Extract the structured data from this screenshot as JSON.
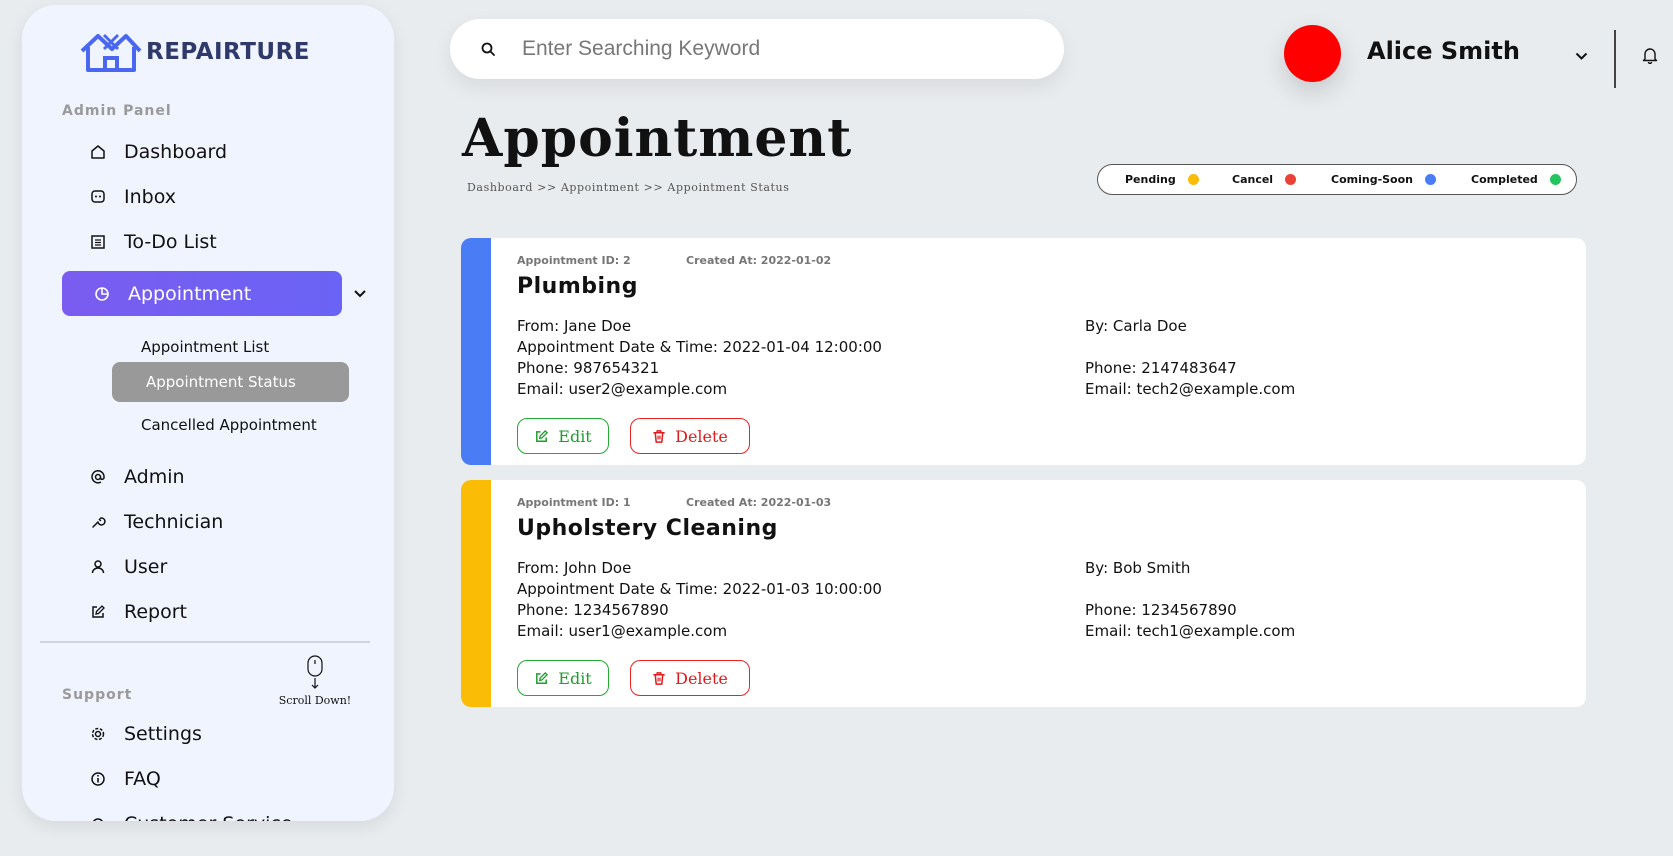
{
  "brand": {
    "name": "REPAIRTURE"
  },
  "sidebar": {
    "admin_label": "Admin Panel",
    "items": [
      {
        "label": "Dashboard",
        "icon": "home-icon"
      },
      {
        "label": "Inbox",
        "icon": "chat-icon"
      },
      {
        "label": "To-Do List",
        "icon": "list-icon"
      },
      {
        "label": "Appointment",
        "icon": "pie-chart-icon",
        "active": true
      },
      {
        "label": "Admin",
        "icon": "at-icon"
      },
      {
        "label": "Technician",
        "icon": "wrench-icon"
      },
      {
        "label": "User",
        "icon": "user-icon"
      },
      {
        "label": "Report",
        "icon": "edit-icon"
      }
    ],
    "appointment_sub": [
      {
        "label": "Appointment List"
      },
      {
        "label": "Appointment Status",
        "active": true
      },
      {
        "label": "Cancelled Appointment"
      }
    ],
    "support_label": "Support",
    "support_items": [
      {
        "label": "Settings",
        "icon": "gear-icon"
      },
      {
        "label": "FAQ",
        "icon": "info-icon"
      },
      {
        "label": "Customer Service",
        "icon": "headset-icon"
      }
    ],
    "scroll_hint": "Scroll Down!"
  },
  "search": {
    "placeholder": "Enter Searching Keyword"
  },
  "user": {
    "name": "Alice Smith",
    "avatar_color": "#ff0000"
  },
  "page": {
    "title": "Appointment",
    "breadcrumb": "Dashboard >> Appointment >> Appointment Status"
  },
  "legend": [
    {
      "label": "Pending",
      "color": "#fbbc05"
    },
    {
      "label": "Cancel",
      "color": "#ea4335"
    },
    {
      "label": "Coming-Soon",
      "color": "#4a7cf6"
    },
    {
      "label": "Completed",
      "color": "#22c55e"
    }
  ],
  "appointments": [
    {
      "id_text": "Appointment ID: 2",
      "created_text": "Created At: 2022-01-02",
      "service": "Plumbing",
      "status_color": "#4a7cf6",
      "from": "From: Jane Doe",
      "datetime": "Appointment Date & Time: 2022-01-04 12:00:00",
      "phone": "Phone: 987654321",
      "email": "Email: user2@example.com",
      "by": "By: Carla Doe",
      "tech_phone": "Phone: 2147483647",
      "tech_email": "Email: tech2@example.com",
      "edit_label": "Edit",
      "delete_label": "Delete"
    },
    {
      "id_text": "Appointment ID: 1",
      "created_text": "Created At: 2022-01-03",
      "service": "Upholstery Cleaning",
      "status_color": "#fbbc05",
      "from": "From: John Doe",
      "datetime": "Appointment Date & Time: 2022-01-03 10:00:00",
      "phone": "Phone: 1234567890",
      "email": "Email: user1@example.com",
      "by": "By: Bob Smith",
      "tech_phone": "Phone: 1234567890",
      "tech_email": "Email: tech1@example.com",
      "edit_label": "Edit",
      "delete_label": "Delete"
    }
  ]
}
